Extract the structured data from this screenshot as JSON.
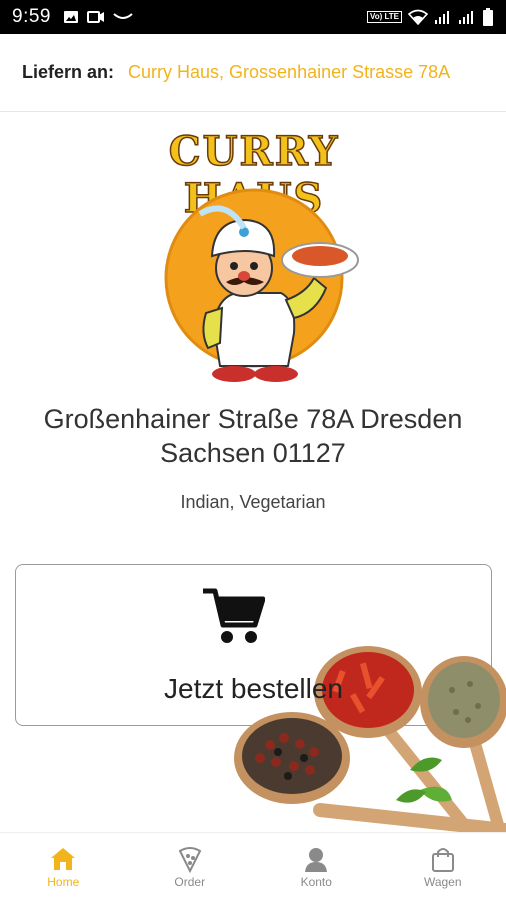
{
  "status_bar": {
    "time": "9:59",
    "network_label": "Vo) LTE"
  },
  "header": {
    "deliver_label": "Liefern an:",
    "deliver_address": "Curry Haus, Grossenhainer Strasse 78A",
    "accent_color": "#f2b31b"
  },
  "restaurant": {
    "logo_text": "CURRY HAUS",
    "address_line1": "Großenhainer Straße 78A Dresden",
    "address_line2": "Sachsen 01127",
    "cuisine": "Indian, Vegetarian"
  },
  "order": {
    "button_label": "Jetzt bestellen",
    "icon": "shopping-cart-icon"
  },
  "bottom_nav": {
    "items": [
      {
        "label": "Home",
        "icon": "home-icon",
        "active": true
      },
      {
        "label": "Order",
        "icon": "pizza-icon",
        "active": false
      },
      {
        "label": "Konto",
        "icon": "user-icon",
        "active": false
      },
      {
        "label": "Wagen",
        "icon": "shopping-bag-icon",
        "active": false
      }
    ]
  }
}
